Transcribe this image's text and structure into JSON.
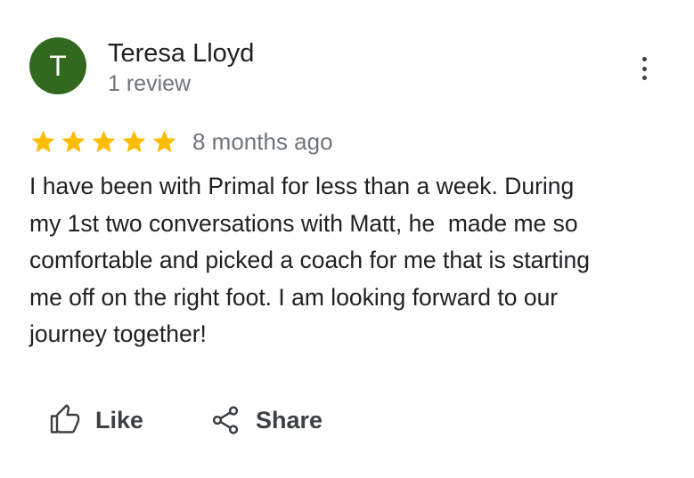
{
  "reviewer": {
    "initial": "T",
    "name": "Teresa Lloyd",
    "review_count": "1 review",
    "avatar_color": "#33691e"
  },
  "menu": {
    "icon": "more-vert-icon"
  },
  "review": {
    "rating": 5,
    "max_rating": 5,
    "star_color": "#fbbc04",
    "time_ago": "8 months ago",
    "text": "I have been with Primal for less than a week. During\nmy 1st two conversations with Matt, he  made me so\ncomfortable and picked a coach for me that is starting\nme off on the right foot. I am looking forward to our\njourney together!"
  },
  "actions": {
    "like_label": "Like",
    "like_icon": "thumb-up-icon",
    "share_label": "Share",
    "share_icon": "share-icon"
  }
}
